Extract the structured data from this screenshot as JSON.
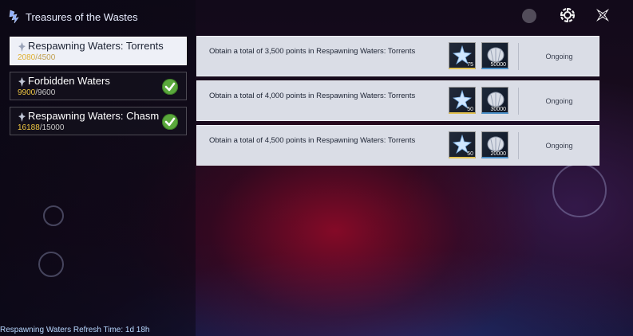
{
  "header": {
    "title": "Treasures of the Wastes",
    "logo_icon": "waves-emblem-icon"
  },
  "top_buttons": [
    {
      "name": "settings-gear-icon"
    },
    {
      "name": "close-icon"
    }
  ],
  "sidebar": {
    "tabs": [
      {
        "label": "Respawning Waters: Torrents",
        "current": "2080",
        "separator": "/",
        "total": "4500",
        "active": true,
        "completed": false
      },
      {
        "label": "Forbidden Waters",
        "current": "9900",
        "separator": "/",
        "total": "9600",
        "active": false,
        "completed": true
      },
      {
        "label": "Respawning Waters: Chasm",
        "current": "16188",
        "separator": "/",
        "total": "15000",
        "active": false,
        "completed": true
      }
    ]
  },
  "quests": [
    {
      "description": "Obtain a total of 3,500 points in Respawning Waters: Torrents",
      "reward1_count": "75",
      "reward2_count": "50000",
      "status": "Ongoing"
    },
    {
      "description": "Obtain a total of 4,000 points in Respawning Waters: Torrents",
      "reward1_count": "50",
      "reward2_count": "30000",
      "status": "Ongoing"
    },
    {
      "description": "Obtain a total of 4,500 points in Respawning Waters: Torrents",
      "reward1_count": "50",
      "reward2_count": "20000",
      "status": "Ongoing"
    }
  ],
  "footer": {
    "refresh_text": "Respawning Waters Refresh Time: 1d 18h"
  },
  "colors": {
    "accent_gold": "#f0c842",
    "check_green": "#5aa83c",
    "quest_bg": "#dadde6"
  }
}
